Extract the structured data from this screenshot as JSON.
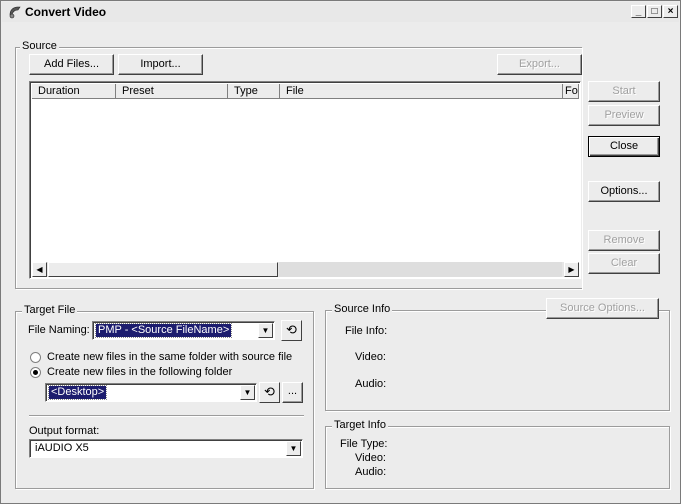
{
  "window": {
    "title": "Convert Video",
    "minimize": "_",
    "maximize": "□",
    "close": "×"
  },
  "source": {
    "legend": "Source",
    "add_files": "Add Files...",
    "import": "Import...",
    "export": "Export...",
    "columns": [
      "Duration",
      "Preset",
      "Type",
      "File",
      "Folde"
    ]
  },
  "side_buttons": {
    "start": "Start",
    "preview": "Preview",
    "close": "Close",
    "options": "Options...",
    "remove": "Remove",
    "clear": "Clear"
  },
  "target_file": {
    "legend": "Target File",
    "file_naming_label": "File Naming:",
    "file_naming_value": "PMP - <Source FileName>",
    "radio_same_folder": "Create new files in the same folder with source file",
    "radio_following_folder": "Create new files in the following folder",
    "folder_value": "<Desktop>",
    "browse": "...",
    "output_format_label": "Output format:",
    "output_format_value": "iAUDIO X5"
  },
  "source_info": {
    "legend": "Source Info",
    "source_options": "Source Options...",
    "file_info": "File Info:",
    "video": "Video:",
    "audio": "Audio:"
  },
  "target_info": {
    "legend": "Target Info",
    "file_type": "File Type:",
    "video": "Video:",
    "audio": "Audio:"
  },
  "icons": {
    "app": "convert-app-icon",
    "undo": "undo-arrow-icon",
    "scroll_left": "scroll-left-icon",
    "scroll_right": "scroll-right-icon",
    "dropdown": "chevron-down-icon"
  }
}
